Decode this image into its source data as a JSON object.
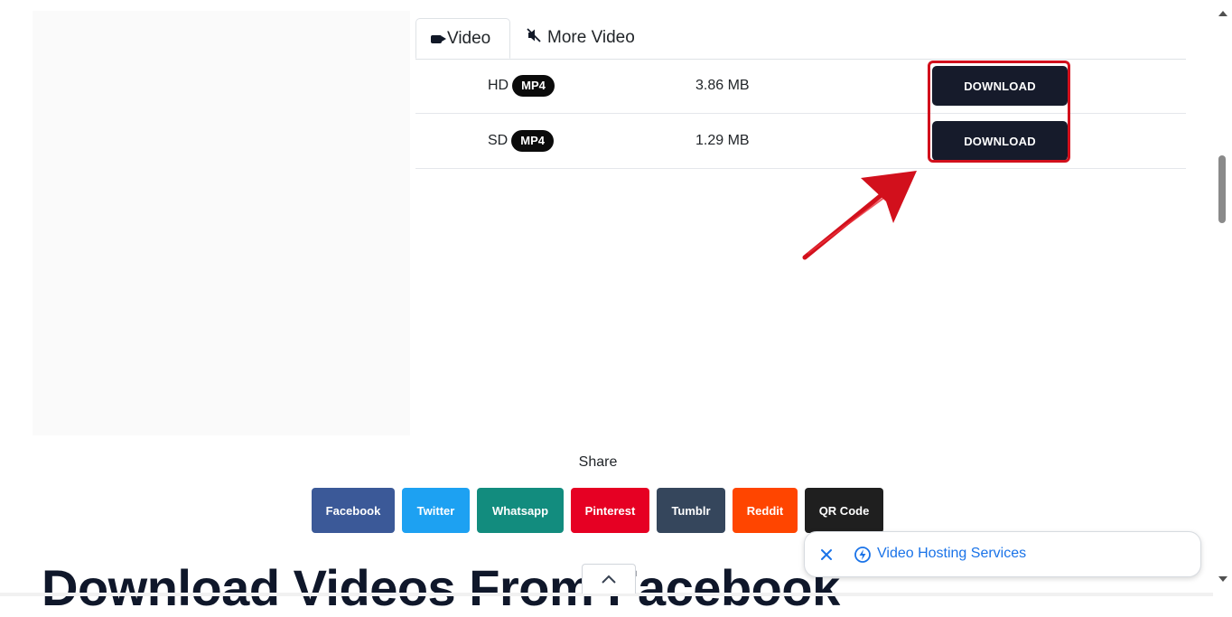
{
  "tabs": {
    "video": "Video",
    "more_video": "More Video"
  },
  "downloads": [
    {
      "quality": "HD",
      "format": "MP4",
      "size": "3.86 MB",
      "button": "DOWNLOAD"
    },
    {
      "quality": "SD",
      "format": "MP4",
      "size": "1.29 MB",
      "button": "DOWNLOAD"
    }
  ],
  "share": {
    "label": "Share",
    "buttons": [
      {
        "label": "Facebook",
        "color": "#3b5998"
      },
      {
        "label": "Twitter",
        "color": "#1da1f2"
      },
      {
        "label": "Whatsapp",
        "color": "#128c7e"
      },
      {
        "label": "Pinterest",
        "color": "#e60023"
      },
      {
        "label": "Tumblr",
        "color": "#35465c"
      },
      {
        "label": "Reddit",
        "color": "#ff4500"
      },
      {
        "label": "QR Code",
        "color": "#1f1f1f"
      }
    ]
  },
  "headline": "Download Videos From Facebook",
  "notification": {
    "text": "Video Hosting Services"
  },
  "colors": {
    "download_button": "#161b2b",
    "highlight": "#d2101c",
    "link": "#1a73e8"
  }
}
